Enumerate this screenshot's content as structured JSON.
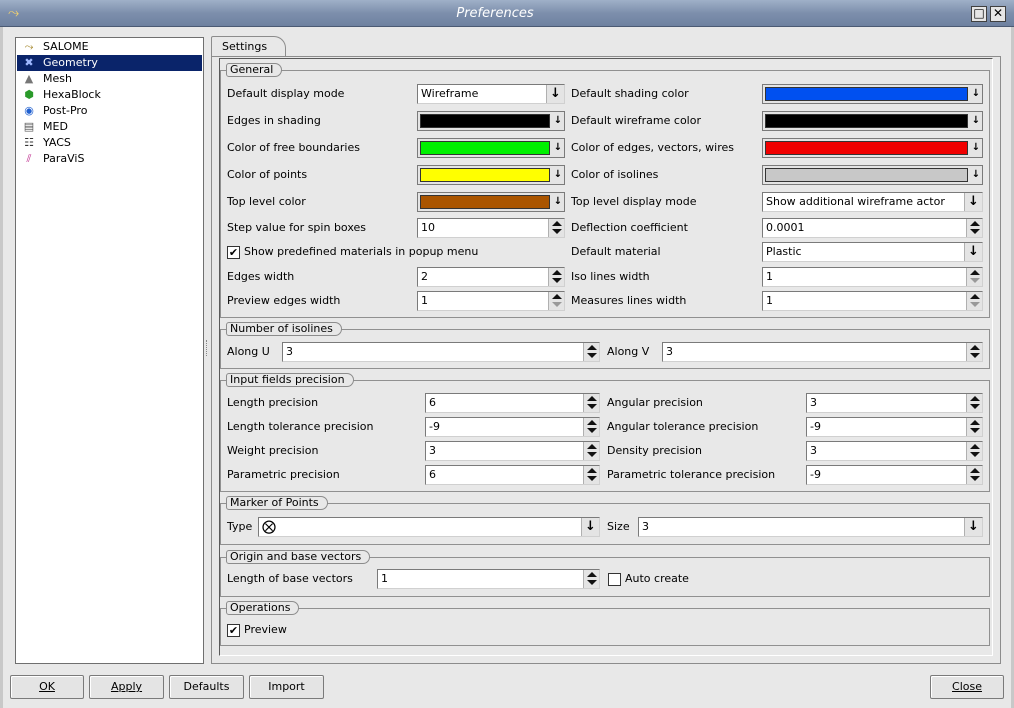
{
  "window": {
    "title": "Preferences"
  },
  "tree": [
    {
      "label": "SALOME",
      "icon": "salome-icon",
      "glyph": "⤳"
    },
    {
      "label": "Geometry",
      "icon": "geometry-icon",
      "glyph": "✖"
    },
    {
      "label": "Mesh",
      "icon": "mesh-icon",
      "glyph": "▲"
    },
    {
      "label": "HexaBlock",
      "icon": "hexablock-icon",
      "glyph": "⬢"
    },
    {
      "label": "Post-Pro",
      "icon": "postpro-icon",
      "glyph": "◉"
    },
    {
      "label": "MED",
      "icon": "med-icon",
      "glyph": "▤"
    },
    {
      "label": "YACS",
      "icon": "yacs-icon",
      "glyph": "☷"
    },
    {
      "label": "ParaViS",
      "icon": "paravis-icon",
      "glyph": "⫽"
    }
  ],
  "tab": {
    "label": "Settings"
  },
  "general": {
    "title": "General",
    "display_mode_label": "Default display mode",
    "display_mode_value": "Wireframe",
    "shading_color_label": "Default shading color",
    "edges_shading_label": "Edges in shading",
    "wireframe_color_label": "Default wireframe color",
    "free_boundaries_label": "Color of free boundaries",
    "edges_vectors_label": "Color of edges, vectors, wires",
    "points_label": "Color of points",
    "isolines_color_label": "Color of isolines",
    "top_level_color_label": "Top level color",
    "top_level_mode_label": "Top level display mode",
    "top_level_mode_value": "Show additional wireframe actor",
    "step_label": "Step value for spin boxes",
    "step_value": "10",
    "deflection_label": "Deflection coefficient",
    "deflection_value": "0.0001",
    "materials_label": "Show predefined materials in popup menu",
    "materials_checked": "✔",
    "default_material_label": "Default material",
    "default_material_value": "Plastic",
    "edges_width_label": "Edges width",
    "edges_width_value": "2",
    "iso_width_label": "Iso lines width",
    "iso_width_value": "1",
    "preview_width_label": "Preview edges width",
    "preview_width_value": "1",
    "measures_width_label": "Measures lines width",
    "measures_width_value": "1"
  },
  "colors": {
    "shading": "#0050f0",
    "edges_shading": "#000000",
    "wireframe": "#000000",
    "free_boundaries": "#00f000",
    "edges_vectors": "#f00000",
    "points": "#ffff00",
    "isolines": "#c8c8c8",
    "top_level": "#aa5500",
    "selection": "#0a246a"
  },
  "isolines": {
    "title": "Number of isolines",
    "u_label": "Along U",
    "u_value": "3",
    "v_label": "Along V",
    "v_value": "3"
  },
  "precision": {
    "title": "Input fields precision",
    "length_label": "Length precision",
    "length_value": "6",
    "angular_label": "Angular precision",
    "angular_value": "3",
    "length_tol_label": "Length tolerance precision",
    "length_tol_value": "-9",
    "angular_tol_label": "Angular tolerance precision",
    "angular_tol_value": "-9",
    "weight_label": "Weight precision",
    "weight_value": "3",
    "density_label": "Density precision",
    "density_value": "3",
    "param_label": "Parametric precision",
    "param_value": "6",
    "param_tol_label": "Parametric tolerance precision",
    "param_tol_value": "-9"
  },
  "marker": {
    "title": "Marker of Points",
    "type_label": "Type",
    "type_icon": "⨂",
    "size_label": "Size",
    "size_value": "3"
  },
  "origin": {
    "title": "Origin and base vectors",
    "length_label": "Length of base vectors",
    "length_value": "1",
    "auto_label": "Auto create",
    "auto_checked": ""
  },
  "operations": {
    "title": "Operations",
    "preview_label": "Preview",
    "preview_checked": "✔"
  },
  "buttons": {
    "ok": "OK",
    "apply": "Apply",
    "defaults": "Defaults",
    "import": "Import",
    "close": "Close"
  }
}
